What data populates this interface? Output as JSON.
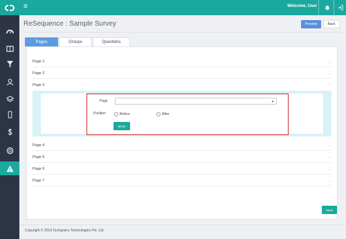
{
  "topbar": {
    "menu_icon": "hamburger-icon",
    "welcome": "Welcome, User"
  },
  "page": {
    "title": "ReSequence : Sample Survey",
    "preview_label": "Preview",
    "back_label": "Back"
  },
  "tabs": [
    {
      "label": "Pages",
      "active": true
    },
    {
      "label": "Groups",
      "active": false
    },
    {
      "label": "Questions",
      "active": false
    }
  ],
  "accordion": {
    "before": [
      "Page 1",
      "Page 2",
      "Page 3"
    ],
    "after": [
      "Page 4",
      "Page 5",
      "Page 6",
      "Page 7"
    ]
  },
  "form": {
    "page_label": "Page",
    "page_value": "",
    "position_label": "Position",
    "before_label": "Before",
    "after_label": "After",
    "move_label": "Move"
  },
  "save_label": "Save",
  "footer": "Copyright © 2018 Techgrains Technologies Pvt. Ltd.",
  "colors": {
    "teal": "#1ba99f",
    "blue": "#5b9be0",
    "sidebar": "#2c3446",
    "highlight": "#d42626"
  }
}
